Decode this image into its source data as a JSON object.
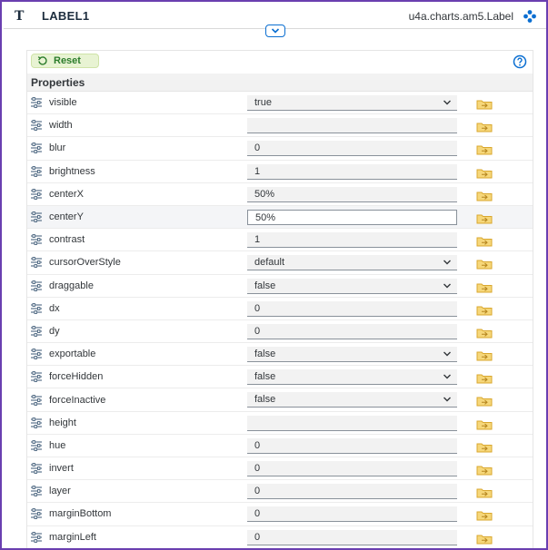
{
  "header": {
    "title": "LABEL1",
    "class_name": "u4a.charts.am5.Label",
    "type_icon": "T"
  },
  "toolbar": {
    "reset_label": "Reset"
  },
  "section": {
    "title": "Properties"
  },
  "properties": [
    {
      "name": "visible",
      "value": "true",
      "type": "select"
    },
    {
      "name": "width",
      "value": "",
      "type": "input"
    },
    {
      "name": "blur",
      "value": "0",
      "type": "input"
    },
    {
      "name": "brightness",
      "value": "1",
      "type": "input"
    },
    {
      "name": "centerX",
      "value": "50%",
      "type": "input"
    },
    {
      "name": "centerY",
      "value": "50%",
      "type": "input",
      "focused": true
    },
    {
      "name": "contrast",
      "value": "1",
      "type": "input"
    },
    {
      "name": "cursorOverStyle",
      "value": "default",
      "type": "select"
    },
    {
      "name": "draggable",
      "value": "false",
      "type": "select"
    },
    {
      "name": "dx",
      "value": "0",
      "type": "input"
    },
    {
      "name": "dy",
      "value": "0",
      "type": "input"
    },
    {
      "name": "exportable",
      "value": "false",
      "type": "select"
    },
    {
      "name": "forceHidden",
      "value": "false",
      "type": "select"
    },
    {
      "name": "forceInactive",
      "value": "false",
      "type": "select"
    },
    {
      "name": "height",
      "value": "",
      "type": "input"
    },
    {
      "name": "hue",
      "value": "0",
      "type": "input"
    },
    {
      "name": "invert",
      "value": "0",
      "type": "input"
    },
    {
      "name": "layer",
      "value": "0",
      "type": "input"
    },
    {
      "name": "marginBottom",
      "value": "0",
      "type": "input"
    },
    {
      "name": "marginLeft",
      "value": "0",
      "type": "input"
    }
  ],
  "colors": {
    "accent": "#0a6ed1",
    "reset_bg": "#e8f3d3",
    "reset_text": "#2b7c2b",
    "bind_icon": "#e9b949",
    "frame": "#6a3fb0"
  }
}
